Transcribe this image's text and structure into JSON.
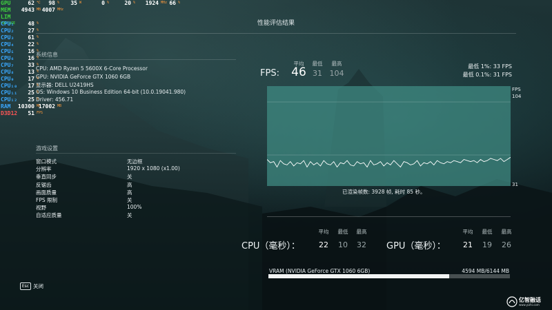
{
  "osd": {
    "rows": [
      {
        "label": "GPU",
        "color": "#3fd13f",
        "values": [
          {
            "v": "62",
            "u": "℃"
          },
          {
            "v": "98",
            "u": "%"
          },
          {
            "v": "35",
            "u": "W"
          },
          {
            "v": "0",
            "u": "%"
          },
          {
            "v": "20",
            "u": "%"
          },
          {
            "v": "1924",
            "u": "MHz"
          },
          {
            "v": "66",
            "u": "%"
          }
        ]
      },
      {
        "label": "MEM",
        "color": "#3fd13f",
        "values": [
          {
            "v": "4943",
            "u": "MB"
          },
          {
            "v": "4007",
            "u": "MHz"
          }
        ]
      },
      {
        "label": "LIM",
        "color": "#3fd13f",
        "sub": "VOLTAGE",
        "values": []
      },
      {
        "label": "CPU₁",
        "color": "#3aa8ff",
        "values": [
          {
            "v": "48",
            "u": "%"
          }
        ]
      },
      {
        "label": "CPU₂",
        "color": "#3aa8ff",
        "values": [
          {
            "v": "27",
            "u": "%"
          }
        ]
      },
      {
        "label": "CPU₃",
        "color": "#3aa8ff",
        "values": [
          {
            "v": "61",
            "u": "%"
          }
        ]
      },
      {
        "label": "CPU₄",
        "color": "#3aa8ff",
        "values": [
          {
            "v": "22",
            "u": "%"
          }
        ]
      },
      {
        "label": "CPU₅",
        "color": "#3aa8ff",
        "values": [
          {
            "v": "16",
            "u": "%"
          }
        ]
      },
      {
        "label": "CPU₆",
        "color": "#3aa8ff",
        "values": [
          {
            "v": "16",
            "u": "%"
          }
        ]
      },
      {
        "label": "CPU₇",
        "color": "#3aa8ff",
        "values": [
          {
            "v": "33",
            "u": "%"
          }
        ]
      },
      {
        "label": "CPU₈",
        "color": "#3aa8ff",
        "values": [
          {
            "v": "13",
            "u": "%"
          }
        ]
      },
      {
        "label": "CPU₉",
        "color": "#3aa8ff",
        "values": [
          {
            "v": "17",
            "u": "%"
          }
        ]
      },
      {
        "label": "CPU₁₀",
        "color": "#3aa8ff",
        "values": [
          {
            "v": "17",
            "u": "%"
          }
        ]
      },
      {
        "label": "CPU₁₁",
        "color": "#3aa8ff",
        "values": [
          {
            "v": "25",
            "u": "%"
          }
        ]
      },
      {
        "label": "CPU₁₂",
        "color": "#3aa8ff",
        "values": [
          {
            "v": "25",
            "u": "%"
          }
        ]
      },
      {
        "label": "RAM",
        "color": "#3aa8ff",
        "values": [
          {
            "v": "10300",
            "u": "MB"
          },
          {
            "v": "17002",
            "u": "MB"
          }
        ]
      },
      {
        "label": "D3D12",
        "color": "#ff5555",
        "values": [
          {
            "v": "51",
            "u": "FPS"
          }
        ]
      }
    ]
  },
  "title": "性能评估结果",
  "system_info": {
    "heading": "系统信息",
    "lines": [
      "CPU: AMD Ryzen 5 5600X 6-Core Processor",
      "GPU: NVIDIA GeForce GTX 1060 6GB",
      "显示器: DELL U2419HS",
      "OS: Windows 10 Business Edition 64-bit (10.0.19041.980)",
      "Driver: 456.71"
    ]
  },
  "game_settings": {
    "heading": "游戏设置",
    "items": [
      {
        "label": "窗口模式",
        "value": "无边框"
      },
      {
        "label": "分辨率",
        "value": "1920 x 1080 (x1.00)"
      },
      {
        "label": "垂直同步",
        "value": "关"
      },
      {
        "label": "反锯齿",
        "value": "高"
      },
      {
        "label": "画面质量",
        "value": "高"
      },
      {
        "label": "FPS 限制",
        "value": "关"
      },
      {
        "label": "视野",
        "value": "100%"
      },
      {
        "label": "自适应质量",
        "value": "关"
      }
    ]
  },
  "fps": {
    "label": "FPS:",
    "headers": {
      "avg": "平均",
      "min": "最低",
      "max": "最高"
    },
    "avg": "46",
    "min": "31",
    "max": "104",
    "low_1": "最低 1%:  33 FPS",
    "low_01": "最低 0.1%:  31 FPS",
    "axis_unit": "FPS",
    "axis_top": "104",
    "axis_bottom": "31",
    "summary": "已渲染帧数: 3928 帧, 耗时 85 秒。"
  },
  "chart_data": {
    "type": "line",
    "title": "",
    "xlabel": "",
    "ylabel": "FPS",
    "ylim": [
      31,
      104
    ],
    "series": [
      {
        "values": [
          51,
          48,
          49,
          44,
          50,
          47,
          46,
          49,
          45,
          48,
          47,
          50,
          44,
          49,
          46,
          48,
          45,
          50,
          47,
          46,
          49,
          44,
          48,
          47,
          50,
          46,
          45,
          49,
          47,
          48,
          44,
          50,
          46,
          47,
          49,
          45,
          48,
          46,
          50,
          47,
          44,
          49,
          48,
          46,
          47,
          50,
          45,
          48,
          47,
          49,
          46,
          50,
          48,
          47,
          49,
          48,
          50,
          49,
          48,
          51,
          50,
          49,
          50,
          48,
          51,
          49,
          50,
          52,
          51,
          50,
          52,
          49,
          51,
          53
        ]
      }
    ]
  },
  "cpu": {
    "label": "CPU（毫秒）：",
    "headers": {
      "avg": "平均",
      "min": "最低",
      "max": "最高"
    },
    "avg": "22",
    "min": "10",
    "max": "32"
  },
  "gpu": {
    "label": "GPU（毫秒）：",
    "headers": {
      "avg": "平均",
      "min": "最低",
      "max": "最高"
    },
    "avg": "21",
    "min": "19",
    "max": "26"
  },
  "vram": {
    "label": "VRAM (NVIDIA GeForce GTX 1060 6GB)",
    "value": "4594 MB/6144 MB",
    "fraction": 0.748
  },
  "footer": {
    "esc_key": "Esc",
    "close_label": "关闭"
  },
  "watermark": {
    "text": "亿智融话",
    "sub": "www.yizhi.com"
  },
  "colors": {
    "graph_fill": "#3f8a82",
    "graph_line": "#ffffff",
    "osd_unit": "#ff9a3c"
  }
}
